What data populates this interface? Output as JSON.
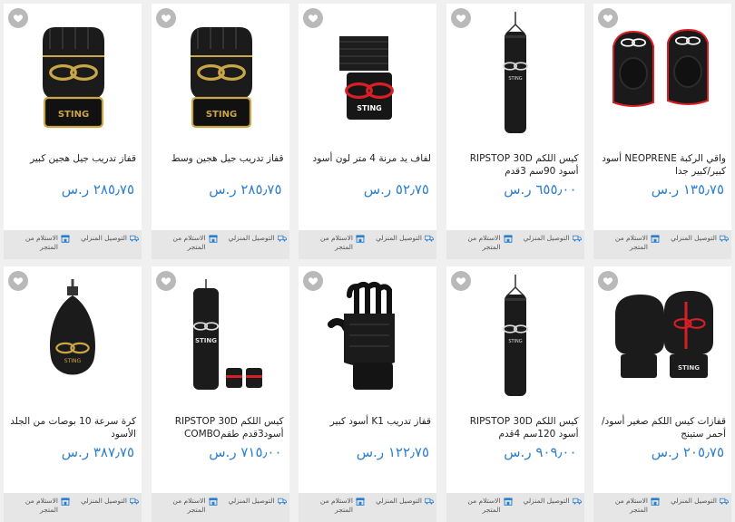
{
  "colors": {
    "price": "#2b7fcf",
    "icon": "#2b7fcf",
    "card_bg": "#ffffff",
    "footer_bg": "#e6e6e6"
  },
  "currency": "ر.س",
  "delivery_label": "التوصيل المنزلي",
  "pickup_label": "الاستلام من المتجر",
  "products": [
    {
      "title": "قفاز تدريب جيل هجين كبير",
      "price": "٢٨٥٫٧٥",
      "image": "gold-hybrid-glove"
    },
    {
      "title": "قفاز تدريب جيل هجين وسط",
      "price": "٢٨٥٫٧٥",
      "image": "gold-hybrid-glove"
    },
    {
      "title": "لفاف يد مرنة 4 متر لون أسود",
      "price": "٥٢٫٧٥",
      "image": "hand-wrap"
    },
    {
      "title": "كيس اللكم RIPSTOP 30D أسود 90سم 3قدم",
      "price": "٦٥٥٫٠٠",
      "image": "punching-bag"
    },
    {
      "title": "واقي الركبة NEOPRENE أسود كبير/كبير جدا",
      "price": "١٣٥٫٧٥",
      "image": "knee-guard"
    },
    {
      "title": "كرة سرعة 10 بوصات من الجلد الأسود",
      "price": "٣٨٧٫٧٥",
      "image": "speed-ball"
    },
    {
      "title": "كيس اللكم RIPSTOP 30D أسود3قدم طقمCOMBO",
      "price": "٧١٥٫٠٠",
      "image": "bag-combo"
    },
    {
      "title": "قفاز تدريب K1 أسود كبير",
      "price": "١٢٢٫٧٥",
      "image": "k1-glove"
    },
    {
      "title": "كيس اللكم RIPSTOP 30D أسود 120سم 4قدم",
      "price": "٩٠٩٫٠٠",
      "image": "punching-bag"
    },
    {
      "title": "قفازات كيس اللكم صغير أسود/أحمر ستينج",
      "price": "٢٠٥٫٧٥",
      "image": "boxing-gloves"
    }
  ]
}
